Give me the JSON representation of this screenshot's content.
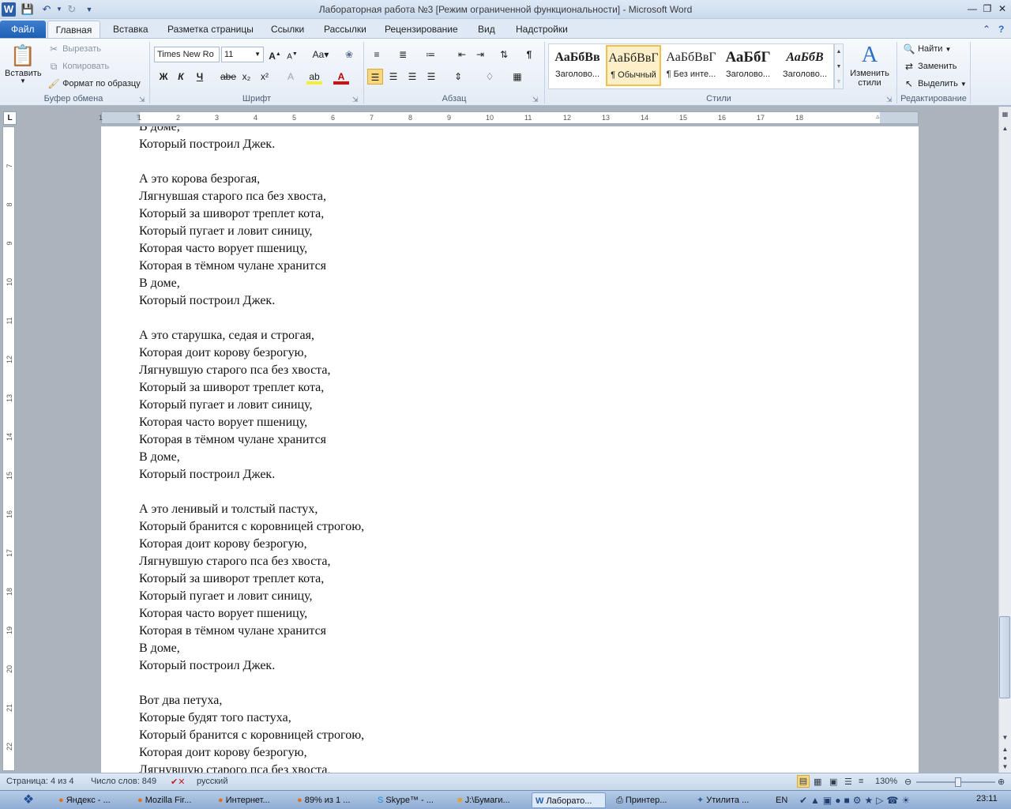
{
  "window": {
    "title": "Лабораторная работа №3 [Режим ограниченной функциональности]  -  Microsoft Word"
  },
  "tabs": [
    {
      "label": "Файл"
    },
    {
      "label": "Главная"
    },
    {
      "label": "Вставка"
    },
    {
      "label": "Разметка страницы"
    },
    {
      "label": "Ссылки"
    },
    {
      "label": "Рассылки"
    },
    {
      "label": "Рецензирование"
    },
    {
      "label": "Вид"
    },
    {
      "label": "Надстройки"
    }
  ],
  "clipboard": {
    "paste": "Вставить",
    "cut": "Вырезать",
    "copy": "Копировать",
    "format_painter": "Формат по образцу",
    "group": "Буфер обмена"
  },
  "font": {
    "name": "Times New Ro",
    "size": "11",
    "group": "Шрифт",
    "bold": "Ж",
    "italic": "К",
    "underline": "Ч",
    "strike": "abe",
    "sub": "x₂",
    "sup": "x²"
  },
  "paragraph": {
    "group": "Абзац"
  },
  "styles": {
    "group": "Стили",
    "items": [
      {
        "sample": "АаБбВв",
        "label": "Заголово..."
      },
      {
        "sample": "АаБбВвГ",
        "label": "¶ Обычный"
      },
      {
        "sample": "АаБбВвГ",
        "label": "¶ Без инте..."
      },
      {
        "sample": "АаБбГ",
        "label": "Заголово..."
      },
      {
        "sample": "АаБбВ",
        "label": "Заголово..."
      }
    ],
    "change": "Изменить стили"
  },
  "editing": {
    "group": "Редактирование",
    "find": "Найти",
    "replace": "Заменить",
    "select": "Выделить"
  },
  "document": {
    "lines": [
      "В доме,",
      "Который построил Джек.",
      "",
      "А это корова безрогая,",
      "Лягнувшая старого пса без хвоста,",
      "Который за шиворот треплет кота,",
      "Который пугает и ловит синицу,",
      "Которая часто ворует пшеницу,",
      "Которая в тёмном чулане хранится",
      "В доме,",
      "Который построил Джек.",
      "",
      "А это старушка, седая и строгая,",
      "Которая доит корову безрогую,",
      "Лягнувшую старого пса без хвоста,",
      "Который за шиворот треплет кота,",
      "Который пугает и ловит синицу,",
      "Которая часто ворует пшеницу,",
      "Которая в тёмном чулане хранится",
      "В доме,",
      "Который построил Джек.",
      "",
      "А это ленивый и толстый пастух,",
      "Который бранится с коровницей строгою,",
      "Которая доит корову безрогую,",
      "Лягнувшую старого пса без хвоста,",
      "Который за шиворот треплет кота,",
      "Который пугает и ловит синицу,",
      "Которая часто ворует пшеницу,",
      "Которая в тёмном чулане хранится",
      "В доме,",
      "Который построил Джек.",
      "",
      "Вот два петуха,",
      "Которые будят того пастуха,",
      "Который бранится с коровницей строгою,",
      "Которая доит корову безрогую,",
      "Лягнувшую старого пса без хвоста,"
    ]
  },
  "ruler": {
    "h": [
      "1",
      "1",
      "2",
      "3",
      "4",
      "5",
      "6",
      "7",
      "8",
      "9",
      "10",
      "11",
      "12",
      "13",
      "14",
      "15",
      "16",
      "17",
      "18"
    ],
    "v": [
      "7",
      "8",
      "9",
      "10",
      "11",
      "12",
      "13",
      "14",
      "15",
      "16",
      "17",
      "18",
      "19",
      "20",
      "21",
      "22"
    ]
  },
  "status": {
    "page": "Страница: 4 из 4",
    "words": "Число слов: 849",
    "lang": "русский",
    "zoom": "130%"
  },
  "taskbar": {
    "items": [
      "Яндекс - ...",
      "Mozilla Fir...",
      "Интернет...",
      "89% из 1 ...",
      "Skype™ - ...",
      "J:\\Бумаги...",
      "Лаборато...",
      "Принтер...",
      "Утилита ..."
    ],
    "lang": "EN",
    "clock": "23:11"
  }
}
